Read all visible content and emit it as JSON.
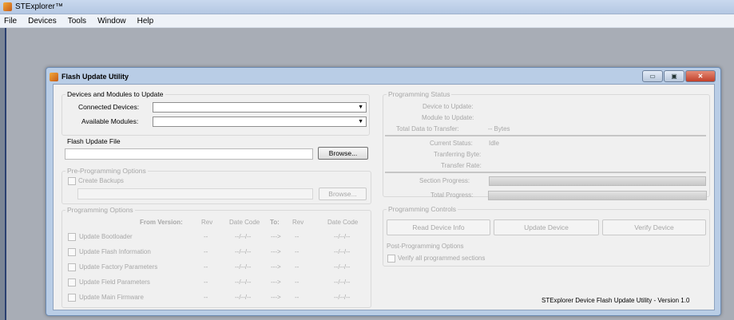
{
  "app": {
    "title": "STExplorer™",
    "menu": [
      "File",
      "Devices",
      "Tools",
      "Window",
      "Help"
    ]
  },
  "dialog": {
    "title": "Flash Update Utility",
    "win_buttons": {
      "minimize": "▭",
      "maximize": "▣",
      "close": "✕"
    },
    "devices_group": {
      "title": "Devices and Modules to Update",
      "connected_label": "Connected Devices:",
      "available_label": "Available Modules:",
      "connected_value": "",
      "available_value": ""
    },
    "flash_file": {
      "title": "Flash Update File",
      "value": "",
      "browse": "Browse..."
    },
    "pre_programming": {
      "title": "Pre-Programming Options",
      "create_backups": "Create Backups",
      "browse": "Browse..."
    },
    "programming_options": {
      "title": "Programming Options",
      "headers": {
        "from_version": "From Version:",
        "rev": "Rev",
        "date_code": "Date Code",
        "to": "To:",
        "to_rev": "Rev",
        "to_date_code": "Date Code"
      },
      "rows": [
        {
          "label": "Update Bootloader",
          "rev": "--",
          "date": "--/--/--",
          "arrow": "--->",
          "to_rev": "--",
          "to_date": "--/--/--"
        },
        {
          "label": "Update Flash Information",
          "rev": "--",
          "date": "--/--/--",
          "arrow": "--->",
          "to_rev": "--",
          "to_date": "--/--/--"
        },
        {
          "label": "Update Factory Parameters",
          "rev": "--",
          "date": "--/--/--",
          "arrow": "--->",
          "to_rev": "--",
          "to_date": "--/--/--"
        },
        {
          "label": "Update Field Parameters",
          "rev": "--",
          "date": "--/--/--",
          "arrow": "--->",
          "to_rev": "--",
          "to_date": "--/--/--"
        },
        {
          "label": "Update Main Firmware",
          "rev": "--",
          "date": "--/--/--",
          "arrow": "--->",
          "to_rev": "--",
          "to_date": "--/--/--"
        }
      ]
    },
    "programming_status": {
      "title": "Programming Status",
      "device_label": "Device to Update:",
      "module_label": "Module to Update:",
      "total_label": "Total Data to Transfer:",
      "total_value": "-- Bytes",
      "current_status_label": "Current Status:",
      "current_status_value": "Idle",
      "transferring_label": "Tranferring Byte:",
      "transfer_rate_label": "Transfer Rate:",
      "section_progress_label": "Section Progress:",
      "total_progress_label": "Total Progress:",
      "section_progress": 0,
      "total_progress": 0
    },
    "programming_controls": {
      "title": "Programming Controls",
      "read_info": "Read Device Info",
      "update_device": "Update Device",
      "verify_device": "Verify Device",
      "post_title": "Post-Programming Options",
      "verify_all": "Verify all programmed sections"
    },
    "footer": "STExplorer Device Flash Update Utility - Version 1.0"
  }
}
